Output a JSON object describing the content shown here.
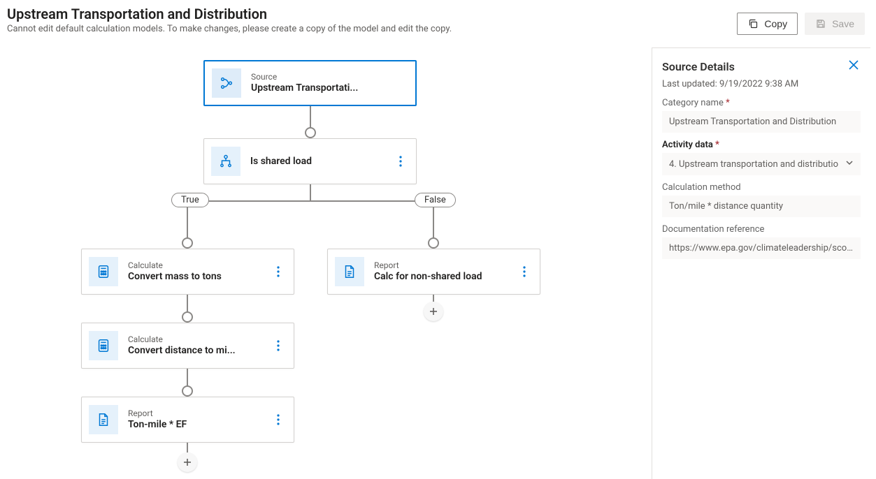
{
  "header": {
    "title": "Upstream Transportation and Distribution",
    "subtitle": "Cannot edit default calculation models. To make changes, please create a copy of the model and edit the copy.",
    "copy_label": "Copy",
    "save_label": "Save"
  },
  "flow": {
    "source": {
      "kind": "Source",
      "title": "Upstream Transportati..."
    },
    "condition": {
      "title": "Is shared load"
    },
    "branch_labels": {
      "true": "True",
      "false": "False"
    },
    "true_branch": [
      {
        "kind": "Calculate",
        "title": "Convert mass to tons"
      },
      {
        "kind": "Calculate",
        "title": "Convert distance to mi..."
      },
      {
        "kind": "Report",
        "title": "Ton-mile * EF"
      }
    ],
    "false_branch": [
      {
        "kind": "Report",
        "title": "Calc for non-shared load"
      }
    ]
  },
  "side": {
    "title": "Source Details",
    "updated_prefix": "Last updated: ",
    "updated_value": "9/19/2022 9:38 AM",
    "labels": {
      "category_name": "Category name",
      "activity_data": "Activity data",
      "calc_method": "Calculation method",
      "doc_ref": "Documentation reference"
    },
    "values": {
      "category_name": "Upstream Transportation and Distribution",
      "activity_data": "4. Upstream transportation and distributio",
      "calc_method": "Ton/mile * distance quantity",
      "doc_ref": "https://www.epa.gov/climateleadership/sco..."
    }
  }
}
